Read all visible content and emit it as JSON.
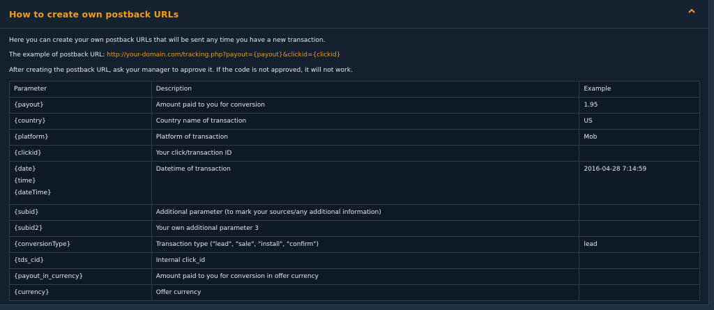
{
  "panel": {
    "title": "How to create own postback URLs",
    "collapse_icon": "chevron-up-icon",
    "accent_color": "#f39a1e"
  },
  "intro": {
    "line1": "Here you can create your own postback URLs that will be sent any time you have a new transaction.",
    "line2_prefix": "The example of postback URL: ",
    "line2_link": "http://your-domain.com/tracking.php?payout={payout}&clickid={clickid}",
    "line3": "After creating the postback URL, ask your manager to approve it. If the code is not approved, it will not work."
  },
  "table": {
    "headers": [
      "Parameter",
      "Description",
      "Example"
    ],
    "rows": [
      {
        "param": [
          "{payout}"
        ],
        "desc": "Amount paid to you for conversion",
        "example": "1.95"
      },
      {
        "param": [
          "{country}"
        ],
        "desc": "Country name of transaction",
        "example": "US"
      },
      {
        "param": [
          "{platform}"
        ],
        "desc": "Platform of transaction",
        "example": "Mob"
      },
      {
        "param": [
          "{clickid}"
        ],
        "desc": "Your click/transaction ID",
        "example": ""
      },
      {
        "param": [
          "{date}",
          "{time}",
          "{dateTime}"
        ],
        "desc": "Datetime of transaction",
        "example": "2016-04-28 7:14:59"
      },
      {
        "param": [
          "{subid}"
        ],
        "desc": "Additional parameter (to mark your sources/any additional information)",
        "example": ""
      },
      {
        "param": [
          "{subid2}"
        ],
        "desc": "Your own additional parameter 3",
        "example": ""
      },
      {
        "param": [
          "{conversionType}"
        ],
        "desc": "Transaction type (\"lead\", \"sale\", \"install\", \"confirm\")",
        "example": "lead"
      },
      {
        "param": [
          "{tds_cid}"
        ],
        "desc": "Internal click_id",
        "example": ""
      },
      {
        "param": [
          "{payout_in_currency}"
        ],
        "desc": "Amount paid to you for conversion in offer currency",
        "example": ""
      },
      {
        "param": [
          "{currency}"
        ],
        "desc": "Offer currency",
        "example": ""
      }
    ]
  }
}
